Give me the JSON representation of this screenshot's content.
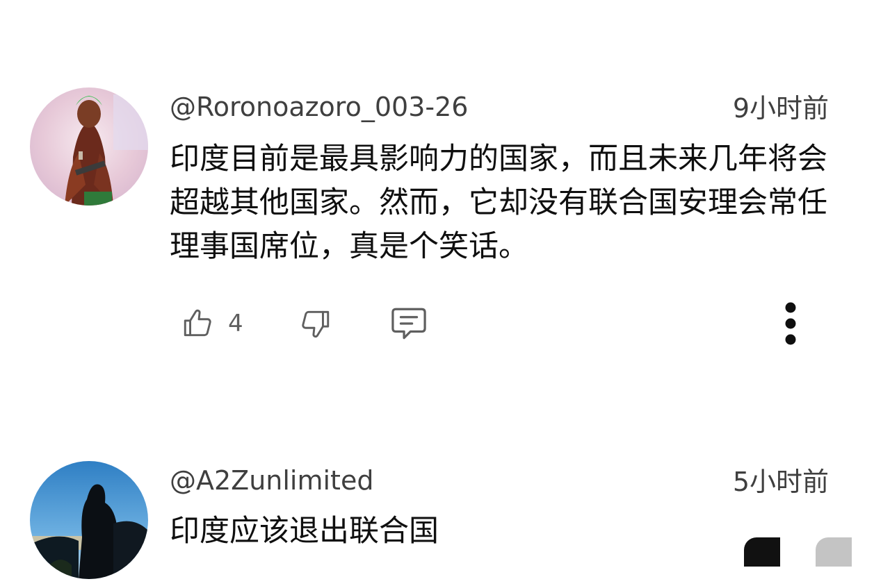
{
  "comments": [
    {
      "handle": "@Roronoazoro_003-26",
      "time": "9小时前",
      "text": "印度目前是最具影响力的国家，而且未来几年将会超越其他国家。然而，它却没有联合国安理会常任理事国席位，真是个笑话。",
      "likes": "4"
    },
    {
      "handle": "@A2Zunlimited",
      "time": "5小时前",
      "text": "印度应该退出联合国"
    }
  ],
  "icons": {
    "like": "thumbs-up-icon",
    "dislike": "thumbs-down-icon",
    "reply": "reply-comment-icon",
    "more": "more-vertical-icon"
  },
  "colors": {
    "text": "#0f0f0f",
    "secondary": "#3f3f3f",
    "icon": "#5f5f5f"
  }
}
